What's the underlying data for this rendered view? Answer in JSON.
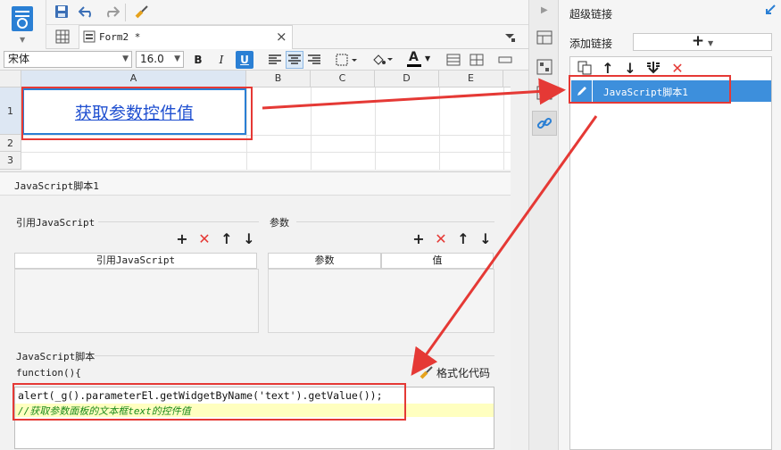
{
  "toolbar": {
    "icons": [
      "report-logo-icon",
      "save-icon",
      "undo-icon",
      "redo-icon",
      "format-brush-icon"
    ]
  },
  "tab": {
    "title": "Form2 *",
    "close": "×",
    "menu_icon": "tab-menu-icon"
  },
  "format": {
    "font_name": "宋体",
    "font_size": "16.0",
    "bold": "B",
    "italic": "I",
    "underline": "U",
    "font_color_letter": "A"
  },
  "sheet": {
    "columns": [
      "A",
      "B",
      "C",
      "D",
      "E"
    ],
    "rows": [
      "1",
      "2",
      "3"
    ],
    "cell_a1": "获取参数控件值"
  },
  "right_panel": {
    "title": "超级链接",
    "add_label": "添加链接",
    "add_button": "+",
    "items": [
      {
        "label": "JavaScript脚本1",
        "selected": true
      }
    ]
  },
  "editor": {
    "title": "JavaScript脚本1",
    "ref_section_label": "引用JavaScript",
    "ref_table_header": "引用JavaScript",
    "params_section_label": "参数",
    "params_headers": [
      "参数",
      "值"
    ],
    "script_section_label": "JavaScript脚本",
    "function_header": "function(){",
    "format_code_label": "格式化代码",
    "code_line1": "alert(_g().parameterEl.getWidgetByName('text').getValue());",
    "code_line2": "//获取参数面板的文本框text的控件值"
  },
  "colors": {
    "accent_blue": "#2a7fd4",
    "selected_blue": "#3d8fdc",
    "annotation_red": "#e53935",
    "comment_green": "#1b8a1b",
    "highlight_yellow": "#ffffc0"
  }
}
